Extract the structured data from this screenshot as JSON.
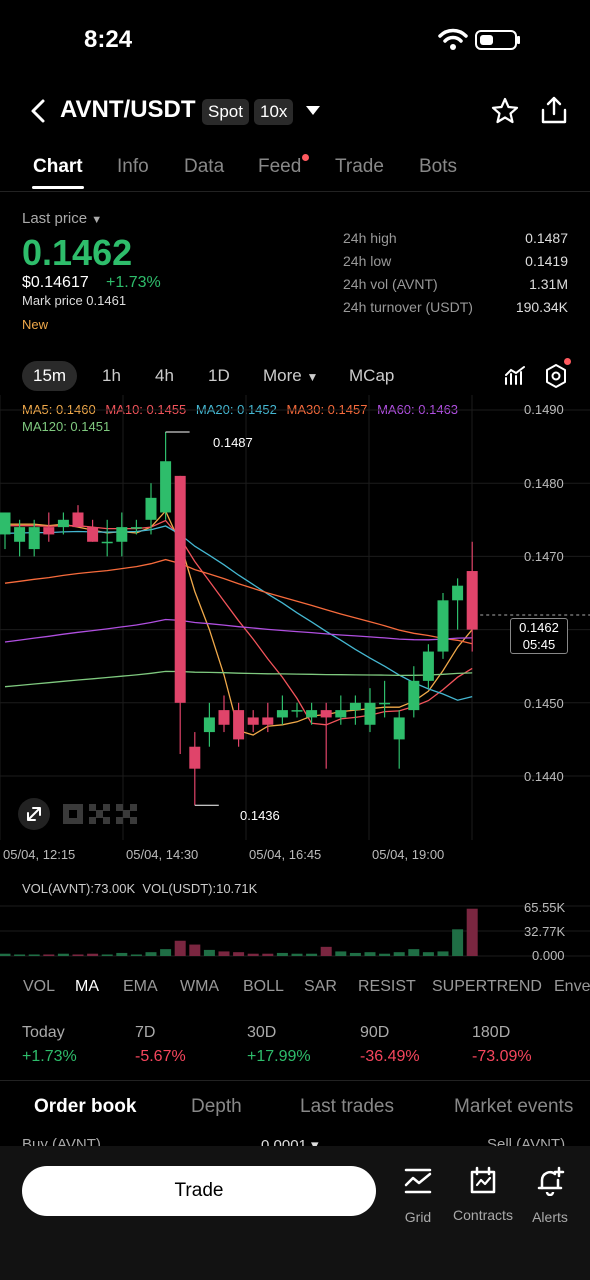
{
  "status": {
    "time": "8:24"
  },
  "header": {
    "pair": "AVNT/USDT",
    "market_badge": "Spot",
    "leverage_badge": "10x"
  },
  "tabs": [
    "Chart",
    "Info",
    "Data",
    "Feed",
    "Trade",
    "Bots"
  ],
  "price": {
    "last_label": "Last price",
    "last": "0.1462",
    "usd": "$0.14617",
    "change": "+1.73%",
    "mark": "Mark price 0.1461",
    "tag": "New"
  },
  "stats": [
    {
      "label": "24h high",
      "value": "0.1487"
    },
    {
      "label": "24h low",
      "value": "0.1419"
    },
    {
      "label": "24h vol (AVNT)",
      "value": "1.31M"
    },
    {
      "label": "24h turnover (USDT)",
      "value": "190.34K"
    }
  ],
  "timeframes": [
    "15m",
    "1h",
    "4h",
    "1D",
    "More",
    "MCap"
  ],
  "ma_legend": [
    {
      "text": "MA5: 0.1460",
      "color": "#f0a94a"
    },
    {
      "text": "MA10: 0.1455",
      "color": "#f2545b"
    },
    {
      "text": "MA20: 0.1452",
      "color": "#45b7d1"
    },
    {
      "text": "MA30: 0.1457",
      "color": "#f76b3c"
    },
    {
      "text": "MA60: 0.1463",
      "color": "#b04fe0"
    },
    {
      "text": "MA120: 0.1451",
      "color": "#7fc97f"
    }
  ],
  "chart_data": {
    "type": "candlestick",
    "ylim": [
      0.1434,
      0.1492
    ],
    "y_ticks": [
      "0.1490",
      "0.1480",
      "0.1470",
      "0.1450",
      "0.1440"
    ],
    "x_ticks": [
      "05/04, 12:15",
      "05/04, 14:30",
      "05/04, 16:45",
      "05/04, 19:00"
    ],
    "high_marker": "0.1487",
    "low_marker": "0.1436",
    "current_price": "0.1462",
    "countdown": "05:45",
    "candles": [
      {
        "o": 0.1473,
        "h": 0.1476,
        "l": 0.1471,
        "c": 0.1476
      },
      {
        "o": 0.1472,
        "h": 0.1475,
        "l": 0.147,
        "c": 0.1474
      },
      {
        "o": 0.1471,
        "h": 0.1475,
        "l": 0.147,
        "c": 0.1474
      },
      {
        "o": 0.1474,
        "h": 0.1476,
        "l": 0.1472,
        "c": 0.1473
      },
      {
        "o": 0.1474,
        "h": 0.1476,
        "l": 0.1473,
        "c": 0.1475
      },
      {
        "o": 0.1476,
        "h": 0.1477,
        "l": 0.1474,
        "c": 0.1474
      },
      {
        "o": 0.1474,
        "h": 0.1475,
        "l": 0.1472,
        "c": 0.1472
      },
      {
        "o": 0.1472,
        "h": 0.1475,
        "l": 0.147,
        "c": 0.1472
      },
      {
        "o": 0.1472,
        "h": 0.1476,
        "l": 0.147,
        "c": 0.1474
      },
      {
        "o": 0.1474,
        "h": 0.1475,
        "l": 0.1473,
        "c": 0.1474
      },
      {
        "o": 0.1475,
        "h": 0.148,
        "l": 0.1473,
        "c": 0.1478
      },
      {
        "o": 0.1476,
        "h": 0.1487,
        "l": 0.1475,
        "c": 0.1483
      },
      {
        "o": 0.1481,
        "h": 0.1481,
        "l": 0.1443,
        "c": 0.145
      },
      {
        "o": 0.1444,
        "h": 0.1446,
        "l": 0.1436,
        "c": 0.1441
      },
      {
        "o": 0.1446,
        "h": 0.145,
        "l": 0.1444,
        "c": 0.1448
      },
      {
        "o": 0.1449,
        "h": 0.1451,
        "l": 0.1446,
        "c": 0.1447
      },
      {
        "o": 0.1449,
        "h": 0.145,
        "l": 0.1444,
        "c": 0.1445
      },
      {
        "o": 0.1448,
        "h": 0.1449,
        "l": 0.1446,
        "c": 0.1447
      },
      {
        "o": 0.1448,
        "h": 0.145,
        "l": 0.1446,
        "c": 0.1447
      },
      {
        "o": 0.1448,
        "h": 0.1451,
        "l": 0.1447,
        "c": 0.1449
      },
      {
        "o": 0.1449,
        "h": 0.145,
        "l": 0.1448,
        "c": 0.1449
      },
      {
        "o": 0.1448,
        "h": 0.145,
        "l": 0.1447,
        "c": 0.1449
      },
      {
        "o": 0.1449,
        "h": 0.145,
        "l": 0.1441,
        "c": 0.1448
      },
      {
        "o": 0.1448,
        "h": 0.1451,
        "l": 0.1447,
        "c": 0.1449
      },
      {
        "o": 0.1449,
        "h": 0.1451,
        "l": 0.1447,
        "c": 0.145
      },
      {
        "o": 0.1447,
        "h": 0.1452,
        "l": 0.1446,
        "c": 0.145
      },
      {
        "o": 0.145,
        "h": 0.1453,
        "l": 0.1448,
        "c": 0.145
      },
      {
        "o": 0.1445,
        "h": 0.1449,
        "l": 0.1441,
        "c": 0.1448
      },
      {
        "o": 0.1449,
        "h": 0.1455,
        "l": 0.1448,
        "c": 0.1453
      },
      {
        "o": 0.1453,
        "h": 0.1458,
        "l": 0.1452,
        "c": 0.1457
      },
      {
        "o": 0.1457,
        "h": 0.1465,
        "l": 0.1456,
        "c": 0.1464
      },
      {
        "o": 0.1464,
        "h": 0.1467,
        "l": 0.146,
        "c": 0.1466
      },
      {
        "o": 0.1468,
        "h": 0.1472,
        "l": 0.1457,
        "c": 0.146
      }
    ],
    "volume_legend": "VOL(AVNT):73.00K  VOL(USDT):10.71K",
    "volume_ticks": [
      "65.55K",
      "32.77K",
      "0.000"
    ],
    "volume_max": 65.55,
    "volumes": [
      3,
      2,
      2,
      2,
      3,
      2,
      3,
      2,
      4,
      2,
      5,
      9,
      20,
      15,
      8,
      6,
      5,
      3,
      3,
      4,
      3,
      3,
      12,
      6,
      4,
      5,
      3,
      5,
      9,
      5,
      6,
      35,
      62
    ]
  },
  "indicators": [
    "VOL",
    "MA",
    "EMA",
    "WMA",
    "BOLL",
    "SAR",
    "RESIST",
    "SUPERTREND",
    "Enve"
  ],
  "performance": [
    {
      "label": "Today",
      "value": "+1.73%",
      "color": "#2ebd6b"
    },
    {
      "label": "7D",
      "value": "-5.67%",
      "color": "#f6465d"
    },
    {
      "label": "30D",
      "value": "+17.99%",
      "color": "#2ebd6b"
    },
    {
      "label": "90D",
      "value": "-36.49%",
      "color": "#f6465d"
    },
    {
      "label": "180D",
      "value": "-73.09%",
      "color": "#f6465d"
    }
  ],
  "orderbook": {
    "tabs": [
      "Order book",
      "Depth",
      "Last trades",
      "Market events"
    ],
    "buy_label": "Buy (AVNT)",
    "precision": "0.0001",
    "sell_label": "Sell (AVNT)"
  },
  "bottom": {
    "trade": "Trade",
    "grid": "Grid",
    "contracts": "Contracts",
    "alerts": "Alerts"
  },
  "colors": {
    "up": "#2ebd6b",
    "down": "#e0446a"
  }
}
